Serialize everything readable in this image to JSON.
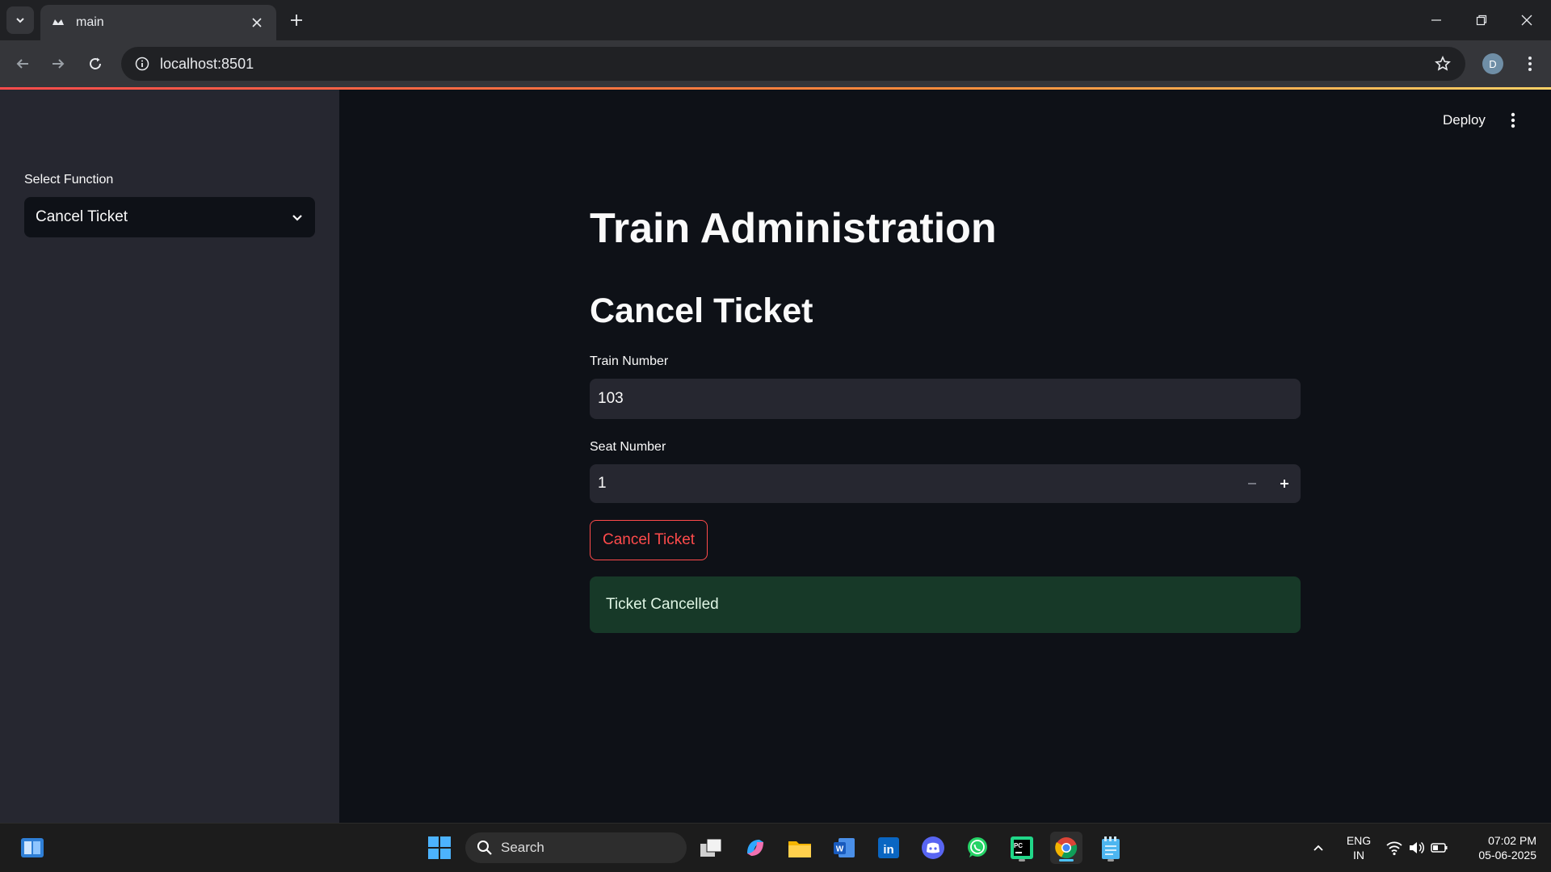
{
  "browser": {
    "tab_title": "main",
    "url": "localhost:8501",
    "profile_initial": "D"
  },
  "sidebar": {
    "select_label": "Select Function",
    "select_value": "Cancel Ticket"
  },
  "header": {
    "deploy_label": "Deploy"
  },
  "main": {
    "title": "Train Administration",
    "subtitle": "Cancel Ticket",
    "train_number_label": "Train Number",
    "train_number_value": "103",
    "seat_number_label": "Seat Number",
    "seat_number_value": "1",
    "cancel_button_label": "Cancel Ticket",
    "success_message": "Ticket Cancelled"
  },
  "taskbar": {
    "search_label": "Search",
    "lang_line1": "ENG",
    "lang_line2": "IN",
    "time": "07:02 PM",
    "date": "05-06-2025"
  },
  "colors": {
    "accent_red": "#ff4b4b",
    "sidebar_bg": "#262730",
    "main_bg": "#0e1117",
    "success_bg": "#173928"
  }
}
